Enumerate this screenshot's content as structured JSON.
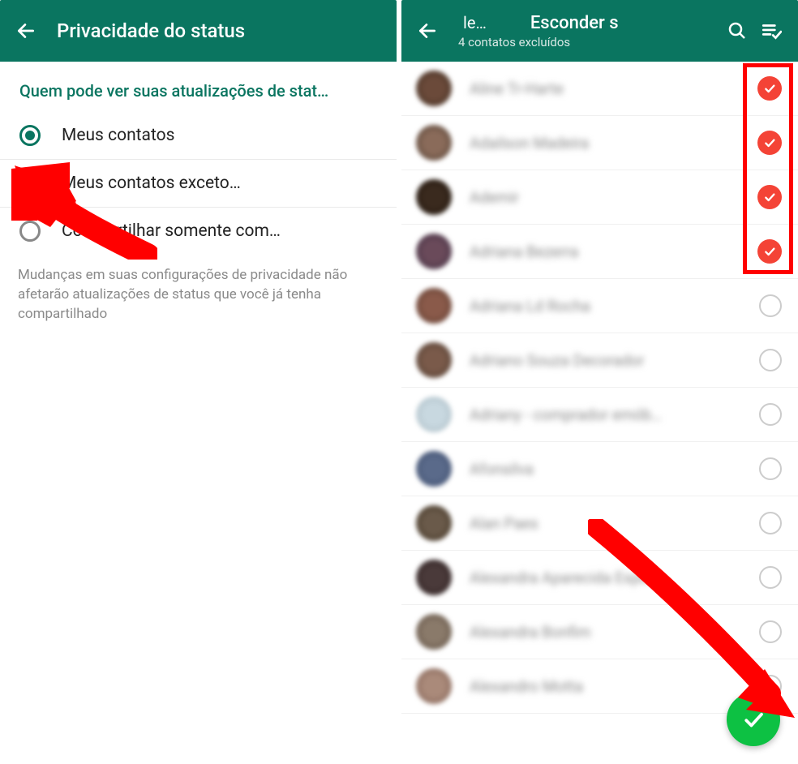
{
  "left": {
    "header": {
      "title": "Privacidade do status"
    },
    "section_title": "Quem pode ver suas atualizações de stat…",
    "options": [
      {
        "label": "Meus contatos",
        "selected": true
      },
      {
        "label": "Meus contatos exceto…",
        "selected": false
      },
      {
        "label": "Compartilhar somente com…",
        "selected": false
      }
    ],
    "helper": "Mudanças em suas configurações de privacidade não afetarão atualizações de status que você já tenha compartilhado"
  },
  "right": {
    "header": {
      "left_trunc": "le…",
      "title": "Esconder s",
      "subtitle": "4 contatos excluídos"
    },
    "contacts": [
      {
        "name": "Aline Tr-Harte",
        "checked": true,
        "avatar": "av1"
      },
      {
        "name": "Adailson Madeira",
        "checked": true,
        "avatar": "av2"
      },
      {
        "name": "Ademir",
        "checked": true,
        "avatar": "av3"
      },
      {
        "name": "Adriana Bezerra",
        "checked": true,
        "avatar": "av4"
      },
      {
        "name": "Adriana Ld Rocha",
        "checked": false,
        "avatar": "av5"
      },
      {
        "name": "Adriano Souza Decorador",
        "checked": false,
        "avatar": "av6"
      },
      {
        "name": "Adriany - comprador emób…",
        "checked": false,
        "avatar": "av7"
      },
      {
        "name": "Afonsilva",
        "checked": false,
        "avatar": "av8"
      },
      {
        "name": "Alan Paes",
        "checked": false,
        "avatar": "av9"
      },
      {
        "name": "Alexandra Aparecida Espen…",
        "checked": false,
        "avatar": "av10"
      },
      {
        "name": "Alexandra Bonfim",
        "checked": false,
        "avatar": "av11"
      },
      {
        "name": "Alexandro Motta",
        "checked": false,
        "avatar": "av12"
      }
    ]
  },
  "icons": {
    "back": "back-arrow-icon",
    "search": "search-icon",
    "select_all": "select-all-icon",
    "check": "check-icon"
  }
}
